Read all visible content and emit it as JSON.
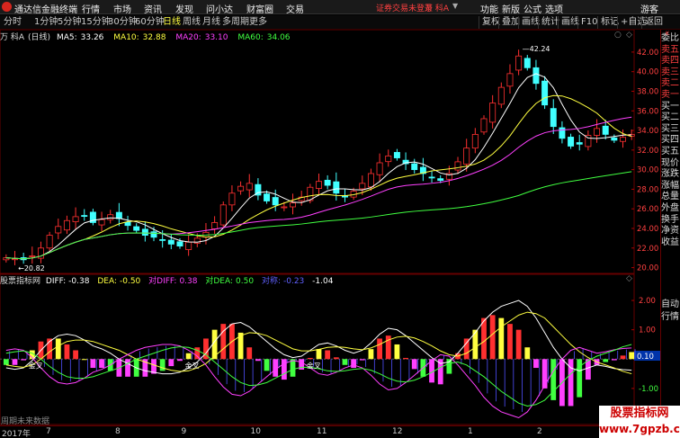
{
  "app": {
    "name": "通达信金融终端",
    "menus": [
      "行情",
      "市场",
      "资讯",
      "发现",
      "问小达",
      "财富圈",
      "交易"
    ],
    "login_notice": "证券交易未登录",
    "stock": "万 科A",
    "right_menus": [
      "功能",
      "新版",
      "公式",
      "选项"
    ],
    "guest": "游客"
  },
  "periods": [
    "分时",
    "1分钟",
    "5分钟",
    "15分钟",
    "30分钟",
    "60分钟",
    "日线",
    "周线",
    "月线",
    "多周期",
    "更多"
  ],
  "active_period": "日线",
  "toolbar": [
    "复权",
    "叠加",
    "画线",
    "统计",
    "画线",
    "F10",
    "标记",
    "+自选",
    "返回"
  ],
  "ma_line": {
    "stock": "万 科A",
    "period": "(日线)",
    "items": [
      {
        "label": "MA5:",
        "value": "33.26",
        "color": "#ffffff"
      },
      {
        "label": "MA10:",
        "value": "32.88",
        "color": "#ffff40"
      },
      {
        "label": "MA20:",
        "value": "33.10",
        "color": "#ff40ff"
      },
      {
        "label": "MA60:",
        "value": "34.06",
        "color": "#40ff40"
      }
    ]
  },
  "macd_line": {
    "name": "股票指标网",
    "items": [
      {
        "label": "DIFF:",
        "value": "-0.38",
        "color": "#ffffff"
      },
      {
        "label": "DEA:",
        "value": "-0.50",
        "color": "#ffff40"
      },
      {
        "label": "对DIFF:",
        "value": "0.38",
        "color": "#ff40ff"
      },
      {
        "label": "对DEA:",
        "value": "0.50",
        "color": "#40ff40"
      },
      {
        "label": "对称:",
        "value": "-0.23",
        "color": "#6060ff"
      },
      {
        "label": "",
        "value": "-1.04",
        "color": "#ffffff"
      }
    ]
  },
  "price_axis": [
    "42.00",
    "40.00",
    "38.00",
    "36.00",
    "34.00",
    "32.00",
    "30.00",
    "28.00",
    "26.00",
    "24.00",
    "22.00",
    "20.00"
  ],
  "macd_axis": [
    "2.00",
    "1.00",
    "-1.00"
  ],
  "macd_current": "0.10",
  "annotations": {
    "high": "42.24",
    "low": "20.82",
    "cross1": "金叉",
    "cross2": "金叉",
    "cross3": "金叉"
  },
  "time_axis": [
    {
      "label": "2017年",
      "pos": 0.0
    },
    {
      "label": "7",
      "pos": 0.07
    },
    {
      "label": "8",
      "pos": 0.18
    },
    {
      "label": "9",
      "pos": 0.285
    },
    {
      "label": "10",
      "pos": 0.395
    },
    {
      "label": "11",
      "pos": 0.5
    },
    {
      "label": "12",
      "pos": 0.62
    },
    {
      "label": "1",
      "pos": 0.74
    },
    {
      "label": "2",
      "pos": 0.85
    }
  ],
  "no_data": "周期未来数据",
  "right_panel": [
    "委比",
    "卖五",
    "卖四",
    "卖三",
    "卖二",
    "卖一",
    "买一",
    "买二",
    "买三",
    "买四",
    "买五",
    "现价",
    "涨跌",
    "涨幅",
    "总量",
    "外盘",
    "换手",
    "净资",
    "收益",
    "自动",
    "行情"
  ],
  "watermark": {
    "line1": "股票指标网",
    "line2": "www.7gpzb.com"
  },
  "colors": {
    "up": "#ff3030",
    "down": "#40ffff",
    "ma5": "#ffffff",
    "ma10": "#ffff40",
    "ma20": "#ff40ff",
    "ma60": "#40ff40",
    "frame": "#660000"
  },
  "chart_data": {
    "type": "candlestick",
    "price_range": [
      19.5,
      43.0
    ],
    "macd_range": [
      -2.2,
      2.4
    ],
    "close": [
      21.0,
      20.9,
      20.8,
      21.2,
      22.0,
      23.3,
      24.2,
      24.8,
      25.2,
      25.3,
      24.6,
      24.9,
      25.4,
      25.0,
      24.3,
      23.8,
      23.3,
      23.1,
      22.8,
      22.4,
      22.2,
      22.6,
      23.0,
      23.6,
      24.6,
      26.4,
      27.6,
      28.3,
      28.6,
      27.4,
      26.8,
      26.4,
      26.2,
      26.6,
      27.2,
      28.2,
      28.8,
      28.4,
      27.6,
      27.2,
      27.8,
      28.6,
      29.6,
      30.7,
      31.4,
      31.2,
      30.6,
      30.0,
      29.6,
      29.2,
      28.9,
      29.6,
      30.8,
      32.2,
      33.6,
      35.2,
      36.8,
      38.4,
      39.8,
      41.6,
      40.4,
      38.8,
      36.6,
      34.4,
      33.2,
      32.4,
      32.6,
      33.5,
      34.2,
      33.6,
      33.0,
      33.3,
      33.6
    ],
    "diff": [
      -0.3,
      -0.35,
      -0.3,
      -0.05,
      0.3,
      0.6,
      0.8,
      0.85,
      0.8,
      0.65,
      0.45,
      0.35,
      0.2,
      0.0,
      -0.15,
      -0.3,
      -0.4,
      -0.45,
      -0.5,
      -0.5,
      -0.45,
      -0.3,
      -0.1,
      0.2,
      0.6,
      0.95,
      1.2,
      1.25,
      1.1,
      0.85,
      0.6,
      0.35,
      0.15,
      0.05,
      0.1,
      0.3,
      0.5,
      0.55,
      0.45,
      0.3,
      0.2,
      0.3,
      0.55,
      0.85,
      1.05,
      1.0,
      0.8,
      0.55,
      0.3,
      0.05,
      -0.15,
      -0.1,
      0.2,
      0.55,
      0.9,
      1.3,
      1.6,
      1.8,
      1.9,
      2.0,
      1.8,
      1.4,
      0.9,
      0.4,
      0.0,
      -0.3,
      -0.4,
      -0.3,
      -0.2,
      -0.25,
      -0.32,
      -0.36,
      -0.38
    ],
    "dea": [
      -0.2,
      -0.25,
      -0.28,
      -0.2,
      0.0,
      0.25,
      0.45,
      0.6,
      0.65,
      0.65,
      0.6,
      0.5,
      0.4,
      0.3,
      0.15,
      0.0,
      -0.1,
      -0.2,
      -0.3,
      -0.38,
      -0.42,
      -0.4,
      -0.3,
      -0.15,
      0.1,
      0.35,
      0.6,
      0.8,
      0.9,
      0.88,
      0.8,
      0.65,
      0.5,
      0.35,
      0.28,
      0.28,
      0.33,
      0.4,
      0.42,
      0.4,
      0.35,
      0.32,
      0.38,
      0.5,
      0.65,
      0.75,
      0.78,
      0.72,
      0.6,
      0.45,
      0.28,
      0.15,
      0.1,
      0.2,
      0.4,
      0.6,
      0.85,
      1.1,
      1.3,
      1.5,
      1.6,
      1.55,
      1.4,
      1.1,
      0.8,
      0.5,
      0.25,
      0.05,
      -0.1,
      -0.2,
      -0.3,
      -0.42,
      -0.5
    ]
  }
}
